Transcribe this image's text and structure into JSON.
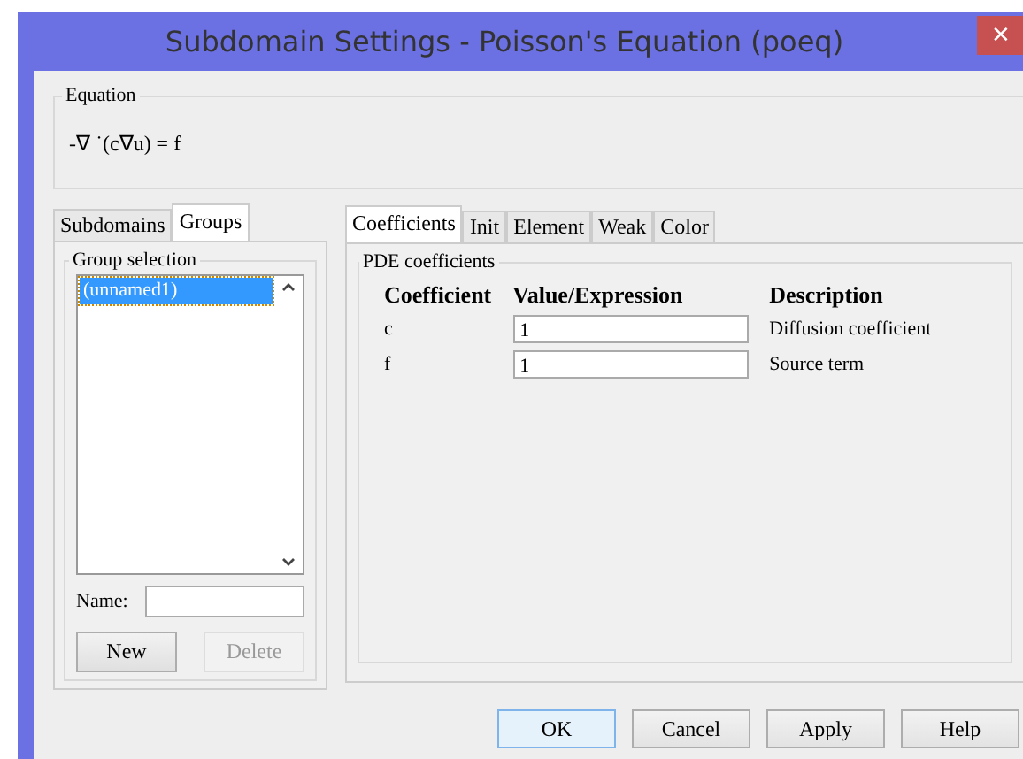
{
  "window": {
    "title": "Subdomain Settings - Poisson's Equation (poeq)",
    "close": "✕"
  },
  "equation": {
    "label": "Equation",
    "text": "-∇  ˙(c∇u) = f"
  },
  "left_tabs": [
    {
      "label": "Subdomains",
      "selected": false
    },
    {
      "label": "Groups",
      "selected": true
    }
  ],
  "group_selection": {
    "label": "Group selection",
    "items": [
      {
        "label": "(unnamed1)",
        "selected": true
      }
    ],
    "name_label": "Name:",
    "buttons": [
      {
        "label": "New",
        "disabled": false
      },
      {
        "label": "Delete",
        "disabled": true
      }
    ]
  },
  "right_tabs": [
    {
      "label": "Coefficients",
      "selected": true
    },
    {
      "label": "Init",
      "selected": false
    },
    {
      "label": "Element",
      "selected": false
    },
    {
      "label": "Weak",
      "selected": false
    },
    {
      "label": "Color",
      "selected": false
    }
  ],
  "pde": {
    "label": "PDE coefficients",
    "columns": [
      "Coefficient",
      "Value/Expression",
      "Description"
    ],
    "rows": [
      {
        "coefficient": "c",
        "value": "1",
        "description": "Diffusion coefficient"
      },
      {
        "coefficient": "f",
        "value": "1",
        "description": "Source term"
      }
    ]
  },
  "buttons": [
    {
      "label": "OK",
      "default": true
    },
    {
      "label": "Cancel",
      "default": false
    },
    {
      "label": "Apply",
      "default": false
    },
    {
      "label": "Help",
      "default": false
    }
  ]
}
